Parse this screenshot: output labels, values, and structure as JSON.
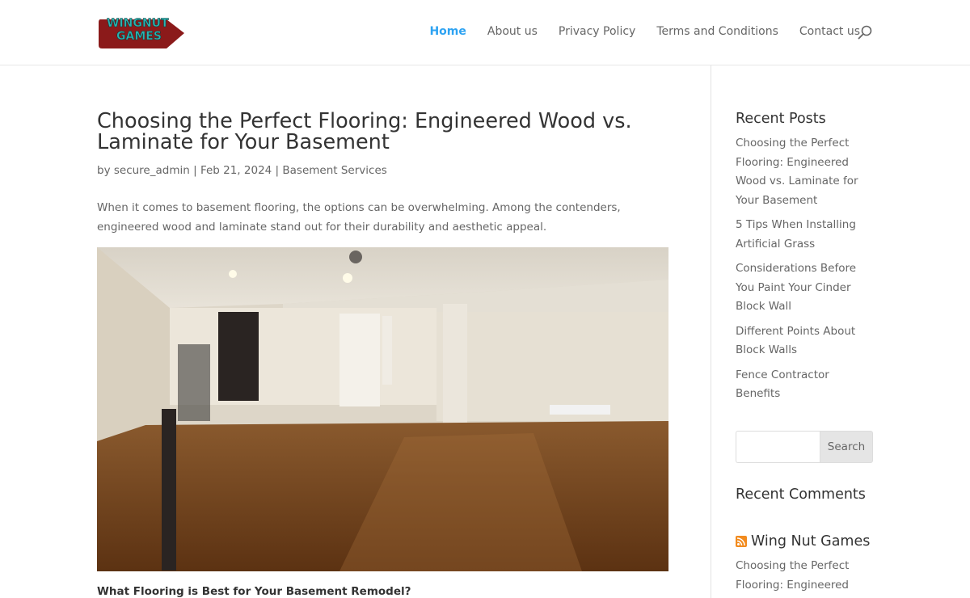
{
  "logo": {
    "line1": "WINGNUT",
    "line2": "GAMES"
  },
  "nav": {
    "items": [
      {
        "label": "Home",
        "active": true
      },
      {
        "label": "About us"
      },
      {
        "label": "Privacy Policy"
      },
      {
        "label": "Terms and Conditions"
      },
      {
        "label": "Contact us"
      }
    ],
    "search_icon": "search-icon"
  },
  "post": {
    "title": "Choosing the Perfect Flooring: Engineered Wood vs. Laminate for Your Basement",
    "meta": {
      "prefix": "by",
      "author": "secure_admin",
      "date": "Feb 21, 2024",
      "category": "Basement Services"
    },
    "intro": "When it comes to basement flooring, the options can be overwhelming. Among the contenders, engineered wood and laminate stand out for their durability and aesthetic appeal.",
    "subheading": "What Flooring is Best for Your Basement Remodel?"
  },
  "sidebar": {
    "recent_posts_title": "Recent Posts",
    "recent_posts": [
      "Choosing the Perfect Flooring: Engineered Wood vs. Laminate for Your Basement",
      "5 Tips When Installing Artificial Grass",
      "Considerations Before You Paint Your Cinder Block Wall",
      "Different Points About Block Walls",
      "Fence Contractor Benefits"
    ],
    "search": {
      "placeholder": "",
      "button": "Search"
    },
    "recent_comments_title": "Recent Comments",
    "rss_title": "Wing Nut Games",
    "rss_post": "Choosing the Perfect Flooring: Engineered"
  },
  "colors": {
    "accent": "#2ea3f2",
    "logo_red": "#8b1a1a",
    "logo_teal": "#2bb3b1"
  }
}
